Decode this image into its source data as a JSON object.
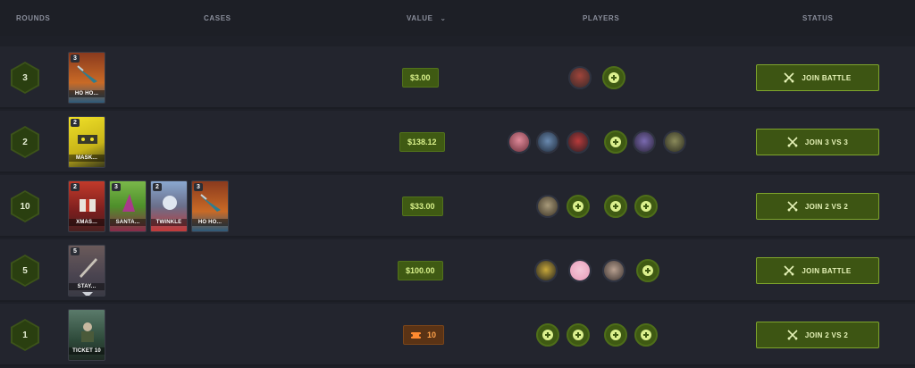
{
  "header": {
    "rounds": "ROUNDS",
    "cases": "CASES",
    "value": "VALUE",
    "sort_icon": "chevron-down-icon",
    "players": "PLAYERS",
    "status": "STATUS"
  },
  "rows": [
    {
      "rounds": "3",
      "cases": [
        {
          "count": "3",
          "name": "HO HO...",
          "color": "#8a3a1e"
        }
      ],
      "value": "$3.00",
      "value_style": "green",
      "players": [
        "avatar",
        "empty"
      ],
      "status": "JOIN BATTLE"
    },
    {
      "rounds": "2",
      "cases": [
        {
          "count": "2",
          "name": "MASK...",
          "color": "#d6c21a"
        }
      ],
      "value": "$138.12",
      "value_style": "green",
      "players": [
        "avatar",
        "avatar",
        "avatar",
        "empty",
        "avatar",
        "avatar"
      ],
      "status": "JOIN 3 VS 3"
    },
    {
      "rounds": "10",
      "cases": [
        {
          "count": "2",
          "name": "XMAS...",
          "color": "#9a2a1e"
        },
        {
          "count": "3",
          "name": "SANTA...",
          "color": "#4e8f2a"
        },
        {
          "count": "2",
          "name": "TWINKLE",
          "color": "#5a5f78"
        },
        {
          "count": "3",
          "name": "HO HO...",
          "color": "#8a3a1e"
        }
      ],
      "value": "$33.00",
      "value_style": "green",
      "players": [
        "avatar",
        "empty",
        "empty",
        "empty"
      ],
      "status": "JOIN 2 VS 2"
    },
    {
      "rounds": "5",
      "cases": [
        {
          "count": "5",
          "name": "STAY...",
          "color": "#5a5560"
        }
      ],
      "value": "$100.00",
      "value_style": "green",
      "players": [
        "avatar",
        "avatar",
        "avatar",
        "empty"
      ],
      "status": "JOIN BATTLE"
    },
    {
      "rounds": "1",
      "cases": [
        {
          "count": "",
          "name": "TICKET 10",
          "color": "#2e4a3a"
        }
      ],
      "value": "10",
      "value_style": "orange",
      "players": [
        "empty",
        "empty",
        "empty",
        "empty"
      ],
      "status": "JOIN 2 VS 2"
    }
  ]
}
